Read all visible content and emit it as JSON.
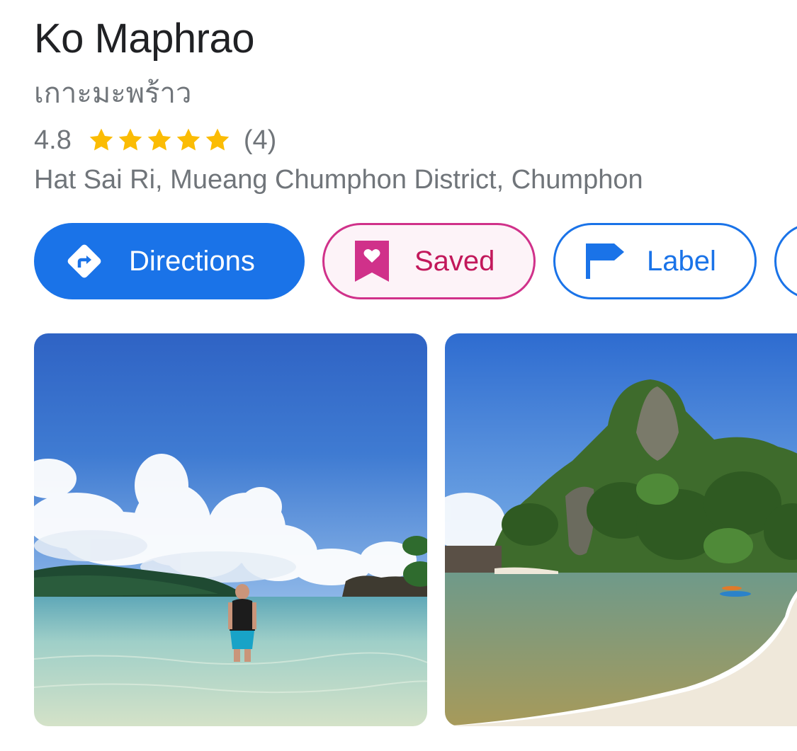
{
  "place": {
    "name": "Ko Maphrao",
    "native_name": "เกาะมะพร้าว",
    "rating": "4.8",
    "stars_filled": 5,
    "stars_total": 5,
    "review_count": "(4)",
    "address": "Hat Sai Ri, Mueang Chumphon District, Chumphon"
  },
  "actions": {
    "directions_label": "Directions",
    "saved_label": "Saved",
    "label_label": "Label"
  },
  "icons": {
    "directions": "directions-diamond-icon",
    "saved": "bookmark-heart-icon",
    "label": "flag-icon",
    "rating": "star-icon"
  },
  "colors": {
    "accent_blue": "#1a73e8",
    "saved_pink": "#c2185b",
    "saved_background": "#fdf3f8",
    "star_yellow": "#fbbc04",
    "secondary_text": "#70757a",
    "primary_text": "#202124"
  },
  "photos": [
    {
      "subject": "beach-person-wading"
    },
    {
      "subject": "beach-cove-rock-island"
    }
  ]
}
